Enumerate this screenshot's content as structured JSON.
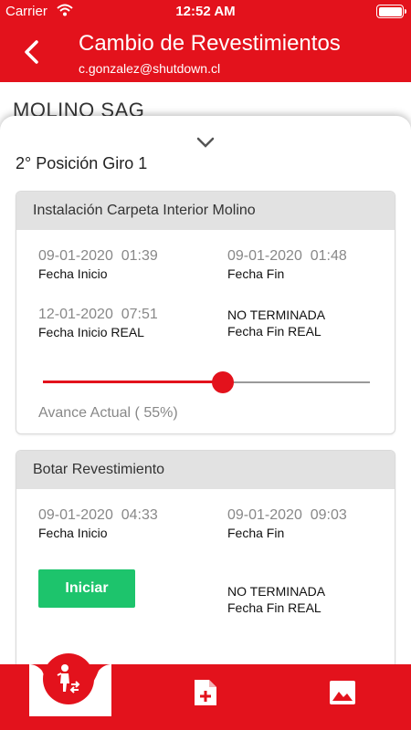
{
  "status_bar": {
    "carrier": "Carrier",
    "time": "12:52 AM"
  },
  "header": {
    "title": "Cambio de Revestimientos",
    "subtitle": "c.gonzalez@shutdown.cl"
  },
  "behind_title": "MOLINO SAG",
  "sheet": {
    "position_label": "2° Posición Giro 1"
  },
  "cards": [
    {
      "title": "Instalación Carpeta Interior Molino",
      "start_planned": "09-01-2020  01:39",
      "start_planned_label": "Fecha Inicio",
      "end_planned": "09-01-2020  01:48",
      "end_planned_label": "Fecha Fin",
      "start_real": "12-01-2020  07:51",
      "start_real_label": "Fecha Inicio REAL",
      "end_real_status": "NO TERMINADA",
      "end_real_label": "Fecha Fin REAL",
      "progress_text": "Avance Actual ( 55%)",
      "progress_fraction": 0.55
    },
    {
      "title": "Botar Revestimiento",
      "start_planned": "09-01-2020  04:33",
      "start_planned_label": "Fecha Inicio",
      "end_planned": "09-01-2020  09:03",
      "end_planned_label": "Fecha Fin",
      "start_button": "Iniciar",
      "end_real_status": "NO TERMINADA",
      "end_real_label": "Fecha Fin REAL"
    }
  ],
  "colors": {
    "brand": "#e3121c",
    "start_button": "#1dc46c"
  },
  "icons": [
    "wifi-icon",
    "battery-icon",
    "back-arrow-icon",
    "chevron-down-icon",
    "worker-swap-icon",
    "add-document-icon",
    "image-icon"
  ]
}
